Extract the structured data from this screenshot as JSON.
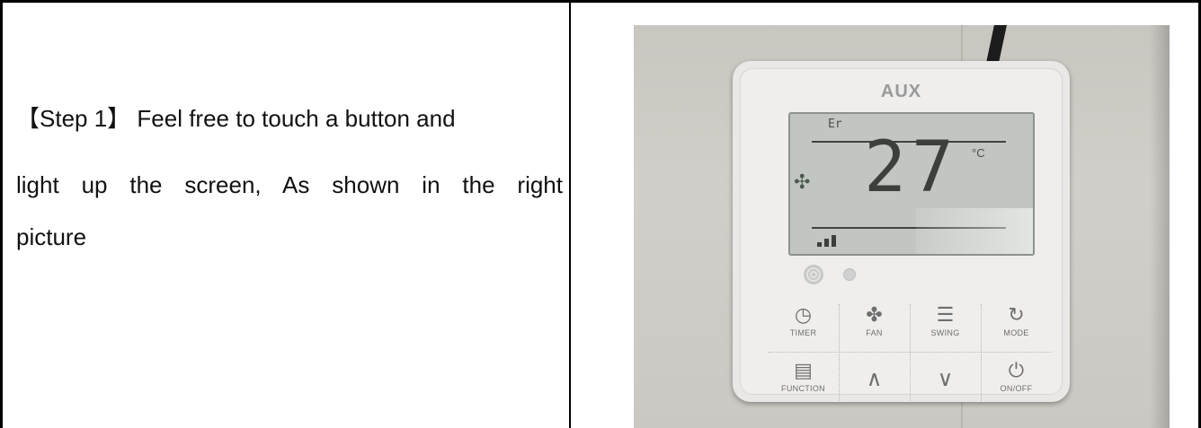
{
  "step": {
    "marker": "【Step 1】",
    "line1": "Feel free to touch a button and",
    "line2": "light up the screen, As shown in the right",
    "line3": "picture"
  },
  "photo": {
    "brand": "AUX",
    "lcd": {
      "status": "Er",
      "temperature": "27",
      "unit": "°C",
      "fan_speed_bars": 3
    },
    "buttons": {
      "timer": "TIMER",
      "fan": "FAN",
      "swing": "SWING",
      "mode": "MODE",
      "function": "FUNCTION",
      "on_off": "ON/OFF"
    },
    "icons": {
      "timer": "clock-icon",
      "fan": "fan-icon",
      "swing": "swing-icon",
      "mode": "mode-cycle-icon",
      "function": "menu-icon",
      "up": "chevron-up-icon",
      "down": "chevron-down-icon",
      "on_off": "power-icon"
    }
  }
}
